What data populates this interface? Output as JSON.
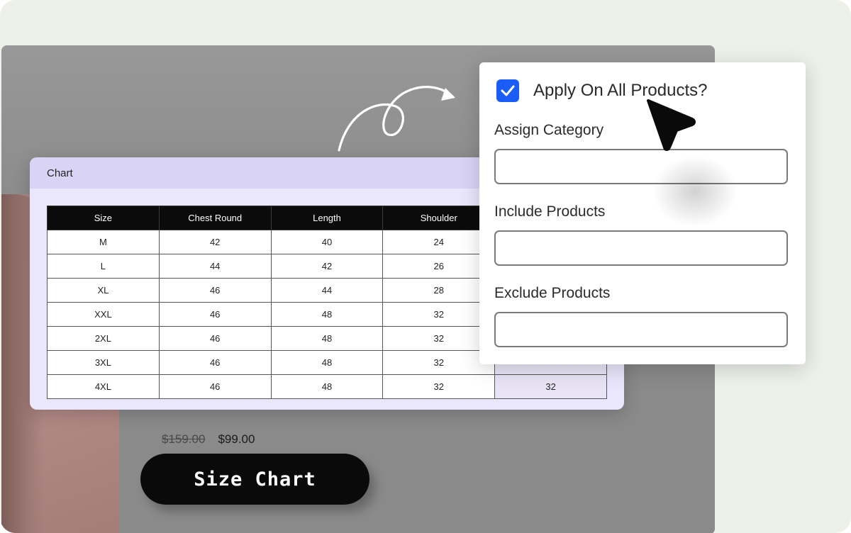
{
  "chart_modal": {
    "title": "Chart",
    "columns": [
      "Size",
      "Chest Round",
      "Length",
      "Shoulder",
      ""
    ],
    "rows": [
      [
        "M",
        "42",
        "40",
        "24",
        ""
      ],
      [
        "L",
        "44",
        "42",
        "26",
        ""
      ],
      [
        "XL",
        "46",
        "44",
        "28",
        ""
      ],
      [
        "XXL",
        "46",
        "48",
        "32",
        ""
      ],
      [
        "2XL",
        "46",
        "48",
        "32",
        ""
      ],
      [
        "3XL",
        "46",
        "48",
        "32",
        ""
      ],
      [
        "4XL",
        "46",
        "48",
        "32",
        "32"
      ]
    ]
  },
  "product": {
    "price_old": "$159.00",
    "price_new": "$99.00",
    "size_chart_button": "Size Chart"
  },
  "settings": {
    "apply_all_label": "Apply On All Products?",
    "apply_all_checked": true,
    "assign_category_label": "Assign Category",
    "assign_category_value": "",
    "include_products_label": "Include Products",
    "include_products_value": "",
    "exclude_products_label": "Exclude Products",
    "exclude_products_value": ""
  },
  "icons": {
    "checkbox": "check-icon",
    "cursor": "pointer-arrow-icon",
    "decor": "curly-arrow-icon"
  },
  "colors": {
    "checkbox": "#1a5cf5",
    "chart_header": "#d9d4f6",
    "table_header": "#0b0b0b",
    "button": "#0a0a0a"
  }
}
